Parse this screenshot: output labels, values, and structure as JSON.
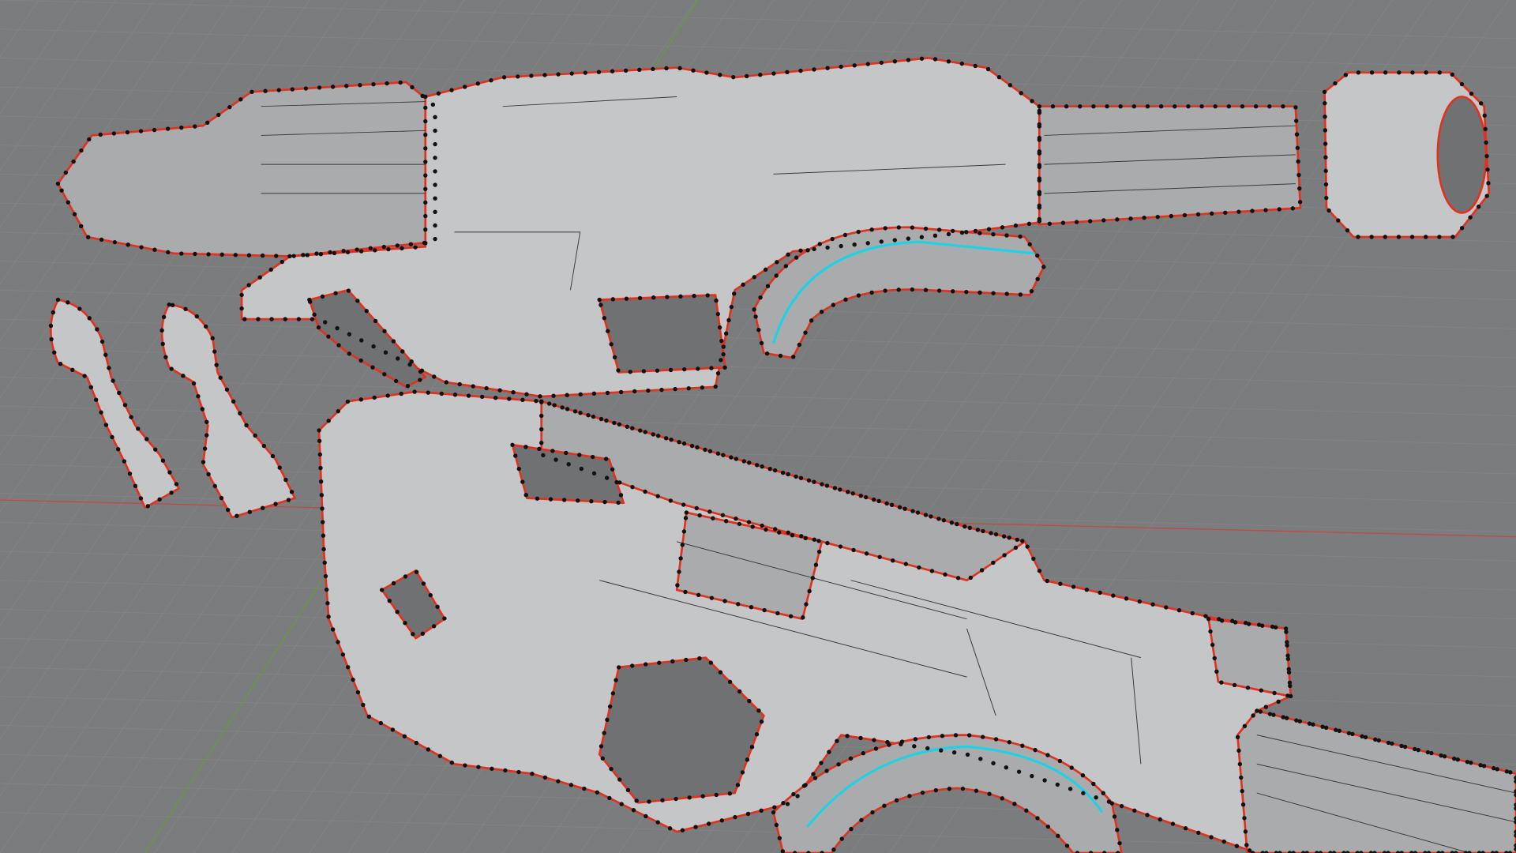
{
  "viewport": {
    "background_color": "#7b7c7d",
    "mesh_fill_color": "#a9abad",
    "selected_edge_color": "#e0331f",
    "seam_edge_color": "#19d3e6",
    "vertex_color": "#111111",
    "x_axis_color": "#c8463c",
    "y_axis_color": "#6a9a3a"
  }
}
